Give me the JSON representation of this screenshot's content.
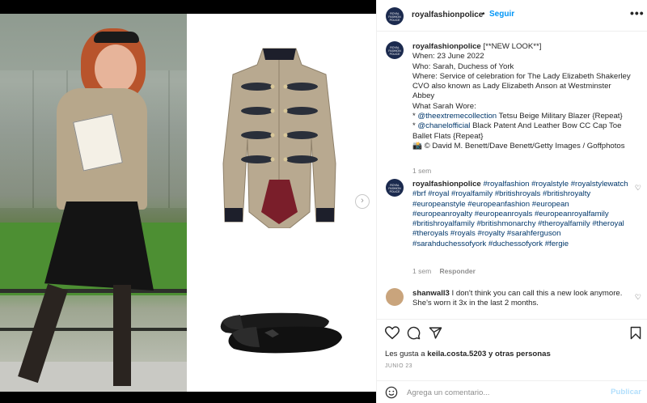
{
  "account": {
    "username": "royalfashionpolice",
    "separator": "•",
    "follow_label": "Seguir",
    "more_label": "•••",
    "avatar_text": "ROYAL FASHION POLICE"
  },
  "caption": {
    "username": "royalfashionpolice",
    "lines": [
      " [**NEW LOOK**]",
      "When: 23 June 2022",
      "Who: Sarah, Duchess of York",
      "Where: Service of celebration for The Lady Elizabeth Shakerley CVO also known as Lady Elizabeth Anson at Westminster Abbey",
      "What Sarah Wore:"
    ],
    "item1_bullet": "* ",
    "item1_mention": "@theextremecollection",
    "item1_text": " Tetsu Beige Military Blazer {Repeat}",
    "item2_bullet": "* ",
    "item2_mention": "@chanelofficial",
    "item2_text": " Black Patent And Leather Bow CC Cap Toe Ballet Flats {Repeat}",
    "credit": "📸 © David M. Benett/Dave Benett/Getty Images / Goffphotos",
    "time": "1 sem"
  },
  "hashtag_comment": {
    "username": "royalfashionpolice",
    "text": "#royalfashion #royalstyle #royalstylewatch #brf #royal #royalfamily #britishroyals #britishroyalty #europeanstyle #europeanfashion #european #europeanroyalty #europeanroyals #europeanroyalfamily #britishroyalfamily #britishmonarchy #theroyalfamily #theroyal #theroyals #royals #royalty #sarahferguson #sarahduchessofyork #duchessofyork #fergie",
    "time": "1 sem",
    "reply_label": "Responder"
  },
  "user_comment": {
    "username": "shanwall3",
    "text": " I don't think you can call this a new look anymore. She's worn it 3x in the last 2 months."
  },
  "likes": {
    "prefix": "Les gusta a ",
    "user": "keila.costa.5203",
    "suffix": " y otras personas"
  },
  "post_date": "JUNIO 23",
  "composer": {
    "placeholder": "Agrega un comentario...",
    "publish_label": "Publicar"
  },
  "media": {
    "next_glyph": "›"
  },
  "colors": {
    "link": "#00376b",
    "follow": "#0095f6",
    "publish_disabled": "#b2dffc",
    "avatar_bg": "#1b2a4e"
  },
  "icons": [
    "heart-icon",
    "comment-icon",
    "share-icon",
    "bookmark-icon",
    "emoji-icon",
    "more-icon",
    "chevron-right-icon"
  ]
}
